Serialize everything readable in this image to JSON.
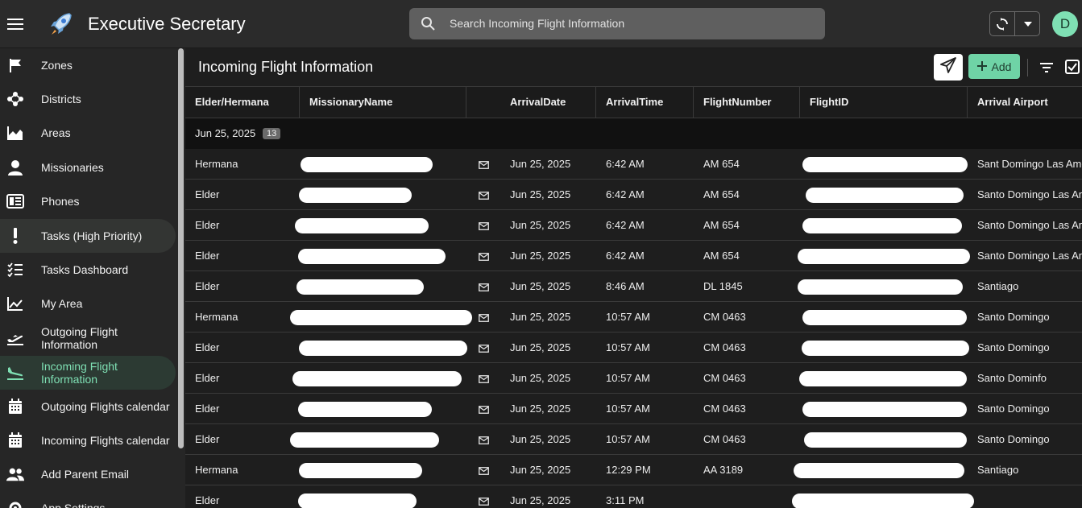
{
  "app": {
    "title": "Executive Secretary",
    "avatar_initial": "D"
  },
  "search": {
    "placeholder": "Search Incoming Flight Information"
  },
  "sidebar": {
    "items": [
      {
        "label": "Zones",
        "icon": "flag-icon"
      },
      {
        "label": "Districts",
        "icon": "network-icon"
      },
      {
        "label": "Areas",
        "icon": "area-chart-icon"
      },
      {
        "label": "Missionaries",
        "icon": "person-icon"
      },
      {
        "label": "Phones",
        "icon": "phone-book-icon"
      },
      {
        "label": "Tasks (High Priority)",
        "icon": "exclamation-icon"
      },
      {
        "label": "Tasks Dashboard",
        "icon": "checklist-icon"
      },
      {
        "label": "My Area",
        "icon": "area-chart-icon"
      },
      {
        "label": "Outgoing Flight Information",
        "icon": "takeoff-icon"
      },
      {
        "label": "Incoming Flight Information",
        "icon": "landing-icon"
      },
      {
        "label": "Outgoing Flights calendar",
        "icon": "calendar-icon"
      },
      {
        "label": "Incoming Flights calendar",
        "icon": "calendar-icon"
      },
      {
        "label": "Add Parent Email",
        "icon": "people-icon"
      },
      {
        "label": "App Settings",
        "icon": "gear-icon"
      }
    ]
  },
  "main": {
    "title": "Incoming Flight Information",
    "add_label": "Add",
    "columns": [
      "Elder/Hermana",
      "MissionaryName",
      "",
      "ArrivalDate",
      "ArrivalTime",
      "FlightNumber",
      "FlightID",
      "Arrival Airport"
    ],
    "group": {
      "label": "Jun 25, 2025",
      "count": "13"
    },
    "rows": [
      {
        "title": "Hermana",
        "date": "Jun 25, 2025",
        "time": "6:42 AM",
        "flight": "AM 654",
        "airport": "Sant Domingo Las Americas"
      },
      {
        "title": "Elder",
        "date": "Jun 25, 2025",
        "time": "6:42 AM",
        "flight": "AM 654",
        "airport": "Santo Domingo Las Americas"
      },
      {
        "title": "Elder",
        "date": "Jun 25, 2025",
        "time": "6:42 AM",
        "flight": "AM 654",
        "airport": "Santo Domingo Las Americas"
      },
      {
        "title": "Elder",
        "date": "Jun 25, 2025",
        "time": "6:42 AM",
        "flight": "AM 654",
        "airport": "Santo Domingo Las Americas"
      },
      {
        "title": "Elder",
        "date": "Jun 25, 2025",
        "time": "8:46 AM",
        "flight": "DL 1845",
        "airport": "Santiago"
      },
      {
        "title": "Hermana",
        "date": "Jun 25, 2025",
        "time": "10:57 AM",
        "flight": "CM 0463",
        "airport": "Santo Domingo"
      },
      {
        "title": "Elder",
        "date": "Jun 25, 2025",
        "time": "10:57 AM",
        "flight": "CM 0463",
        "airport": "Santo Domingo"
      },
      {
        "title": "Elder",
        "date": "Jun 25, 2025",
        "time": "10:57 AM",
        "flight": "CM 0463",
        "airport": "Santo Dominfo"
      },
      {
        "title": "Elder",
        "date": "Jun 25, 2025",
        "time": "10:57 AM",
        "flight": "CM 0463",
        "airport": "Santo Domingo"
      },
      {
        "title": "Elder",
        "date": "Jun 25, 2025",
        "time": "10:57 AM",
        "flight": "CM 0463",
        "airport": "Santo Domingo"
      },
      {
        "title": "Hermana",
        "date": "Jun 25, 2025",
        "time": "12:29 PM",
        "flight": "AA 3189",
        "airport": "Santiago"
      },
      {
        "title": "Elder",
        "date": "Jun 25, 2025",
        "time": "3:11 PM",
        "flight": "",
        "airport": ""
      }
    ]
  },
  "colors": {
    "accent": "#7fe0b4",
    "add_button": "#6fd3a6",
    "background": "#1e1e1e"
  }
}
